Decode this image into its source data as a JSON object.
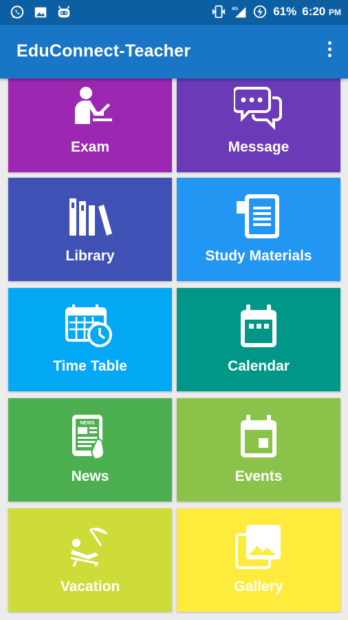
{
  "status_bar": {
    "battery": "61%",
    "network": "4G",
    "time": "6:20",
    "ampm": "PM",
    "left_icons": [
      "whatsapp-icon",
      "gallery-icon",
      "cyanogen-icon"
    ],
    "right_icons": [
      "vibrate-icon",
      "signal-icon",
      "battery-charging-icon"
    ]
  },
  "app_bar": {
    "title": "EduConnect-Teacher",
    "menu_icon": "overflow-menu-icon"
  },
  "tiles": [
    {
      "label": "Exam",
      "icon": "exam-icon",
      "color": "#9c27b0"
    },
    {
      "label": "Message",
      "icon": "message-icon",
      "color": "#6a3ab7"
    },
    {
      "label": "Library",
      "icon": "library-icon",
      "color": "#3f51b5"
    },
    {
      "label": "Study Materials",
      "icon": "study-materials-icon",
      "color": "#2196f3"
    },
    {
      "label": "Time Table",
      "icon": "time-table-icon",
      "color": "#03a9f4"
    },
    {
      "label": "Calendar",
      "icon": "calendar-icon",
      "color": "#009688"
    },
    {
      "label": "News",
      "icon": "news-icon",
      "color": "#4caf50"
    },
    {
      "label": "Events",
      "icon": "events-icon",
      "color": "#8bc34a"
    },
    {
      "label": "Vacation",
      "icon": "vacation-icon",
      "color": "#cddc39"
    },
    {
      "label": "Gallery",
      "icon": "gallery-icon",
      "color": "#ffeb3b"
    }
  ],
  "news_badge": "NEWS"
}
